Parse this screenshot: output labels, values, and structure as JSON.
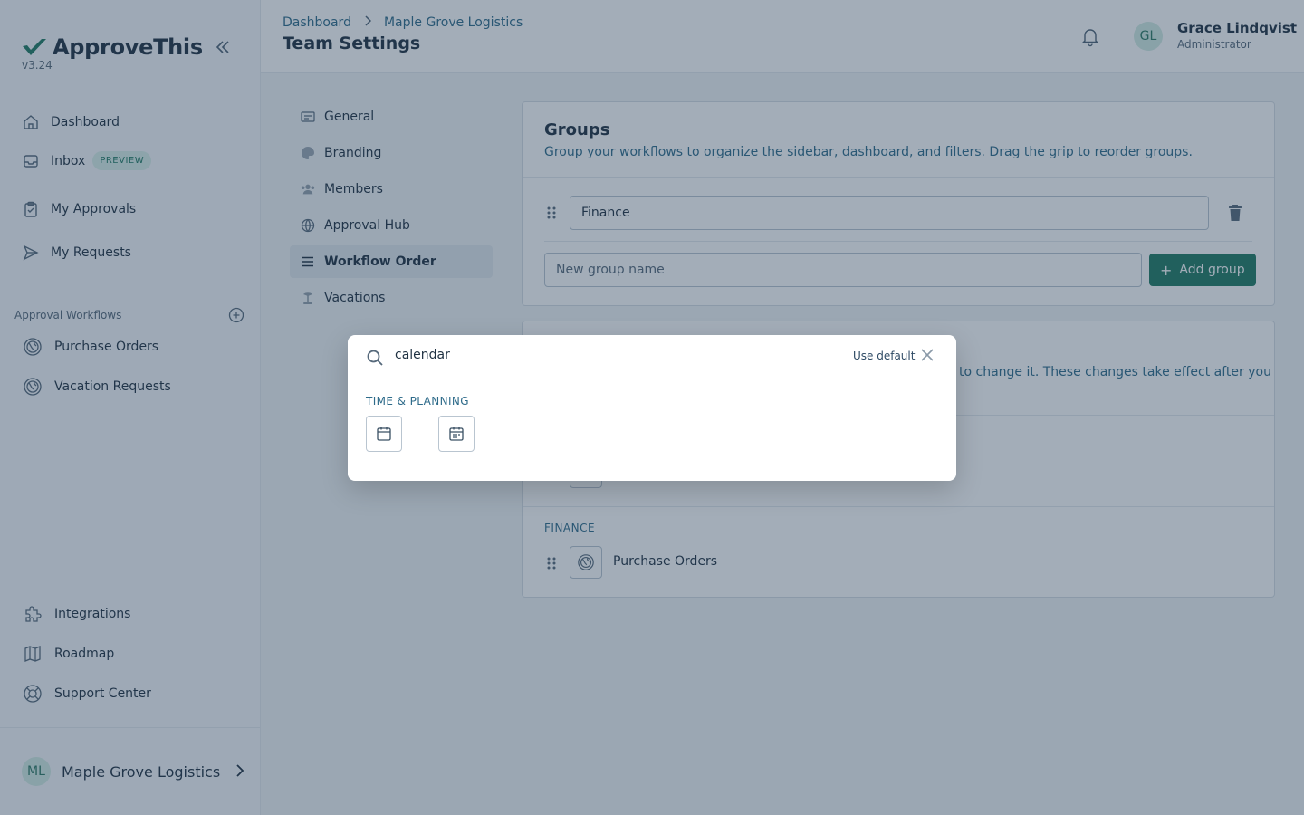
{
  "brand": {
    "name": "ApproveThis",
    "version": "v3.24"
  },
  "sidebar": {
    "nav": [
      {
        "label": "Dashboard",
        "icon": "home-icon"
      },
      {
        "label": "Inbox",
        "icon": "inbox-icon",
        "badge": "PREVIEW"
      },
      {
        "label": "My Approvals",
        "icon": "clipboard-icon"
      },
      {
        "label": "My Requests",
        "icon": "send-icon"
      }
    ],
    "section_label": "Approval Workflows",
    "workflows": [
      {
        "label": "Purchase Orders",
        "icon": "globe-icon"
      },
      {
        "label": "Vacation Requests",
        "icon": "globe-icon"
      }
    ],
    "bottom": [
      {
        "label": "Integrations",
        "icon": "puzzle-icon"
      },
      {
        "label": "Roadmap",
        "icon": "map-icon"
      },
      {
        "label": "Support Center",
        "icon": "lifebuoy-icon"
      }
    ],
    "org": {
      "initials": "ML",
      "name": "Maple Grove Logistics"
    }
  },
  "header": {
    "breadcrumb": [
      "Dashboard",
      "Maple Grove Logistics"
    ],
    "title": "Team Settings",
    "user": {
      "initials": "GL",
      "name": "Grace Lindqvist",
      "role": "Administrator"
    }
  },
  "settings_nav": [
    {
      "label": "General"
    },
    {
      "label": "Branding"
    },
    {
      "label": "Members"
    },
    {
      "label": "Approval Hub"
    },
    {
      "label": "Workflow Order",
      "active": true
    },
    {
      "label": "Vacations"
    }
  ],
  "groups_card": {
    "title": "Groups",
    "description": "Group your workflows to organize the sidebar, dashboard, and filters. Drag the grip to reorder groups.",
    "groups": [
      {
        "name": "Finance"
      }
    ],
    "new_group_placeholder": "New group name",
    "add_button": "Add group"
  },
  "order_card": {
    "partial_text": "to change it. These changes take effect after you",
    "group_label": "FINANCE",
    "workflows": [
      {
        "name": "Purchase Orders"
      }
    ]
  },
  "icon_picker": {
    "search_value": "calendar",
    "use_default": "Use default",
    "category": "TIME & PLANNING",
    "icons": [
      "calendar-icon",
      "calendar-event-icon"
    ]
  },
  "colors": {
    "accent": "#1f7a63",
    "overlay": "#233c55"
  }
}
